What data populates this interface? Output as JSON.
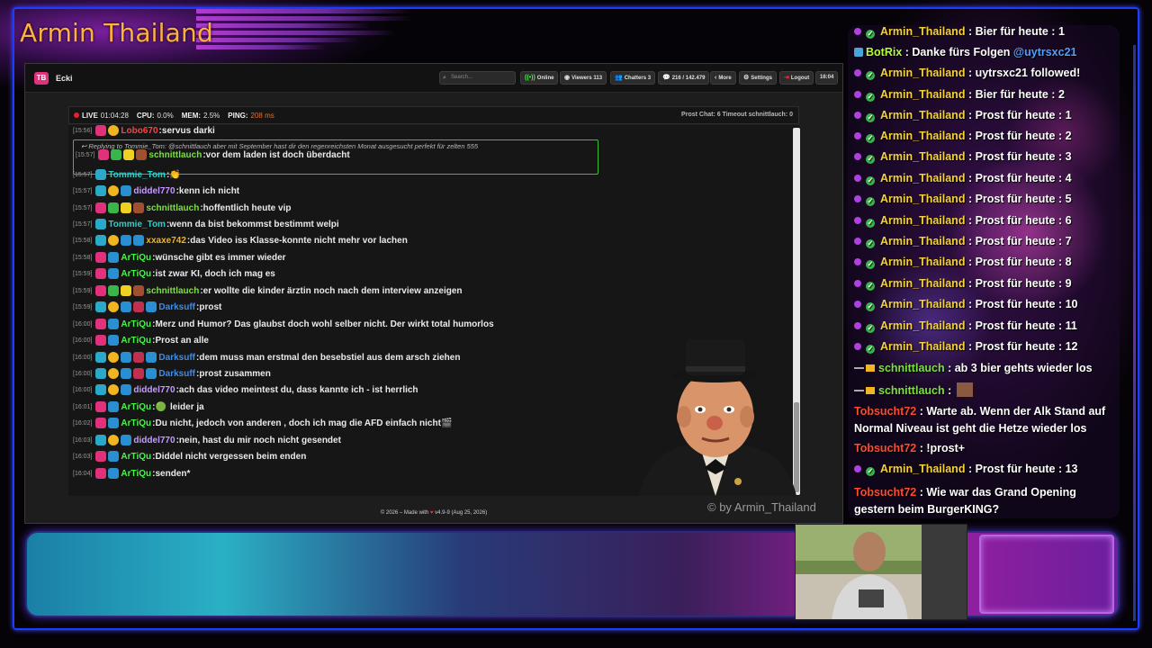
{
  "overlay": {
    "streamer_title": "Armin Thailand",
    "copyright": "© by Armin_Thailand"
  },
  "app": {
    "name": "Ecki",
    "logo_text": "TB",
    "search_placeholder": "Search...",
    "toolbar": {
      "online": "Online",
      "viewers_label": "Viewers",
      "viewers_count": "113",
      "chatters_label": "Chatters",
      "chatters_count": "3",
      "messages": "216 / 142.479",
      "more": "More",
      "settings": "Settings",
      "logout": "Logout",
      "clock": "16:04"
    },
    "status": {
      "live_label": "LIVE",
      "live_time": "01:04:28",
      "cpu_label": "CPU:",
      "cpu_value": "0.0%",
      "mem_label": "MEM:",
      "mem_value": "2.5%",
      "ping_label": "PING:",
      "ping_value": "208 ms",
      "right_text": "Prost Chat: 6  Timeout schnittlauch: 0"
    },
    "footer_prefix": "© 2026 – Made with",
    "footer_suffix": "v4.9-9 (Aug 25, 2026)"
  },
  "chat": {
    "partial_top": {
      "time": "[15:56]",
      "user": "Lobo670",
      "text": "servus darki"
    },
    "reply_context": "Replying to Tommie_Tom: @schnittlauch aber mit September hast dir den regenreichsten Monat ausgesucht perfekt für zelten 555",
    "messages": [
      {
        "time": "[15:57]",
        "user": "schnittlauch",
        "text": "vor dem laden ist doch überdacht",
        "color": "#7be040",
        "badges": [
          "#e0317a",
          "#3ab54a",
          "#f0d020",
          "#a05030"
        ]
      },
      {
        "time": "[15:57]",
        "user": "Tommie_Tom",
        "text": "",
        "color": "#2ad1c9",
        "badges": [
          "#2aa9c9"
        ],
        "emote": "👏"
      },
      {
        "time": "[15:57]",
        "user": "diddel770",
        "text": "kenn ich nicht",
        "color": "#c49cff",
        "badges": [
          "#2aa9c9",
          "#f0b520",
          "#2a8fd0"
        ]
      },
      {
        "time": "[15:57]",
        "user": "schnittlauch",
        "text": "hoffentlich heute vip",
        "color": "#7be040",
        "badges": [
          "#e0317a",
          "#3ab54a",
          "#f0d020",
          "#a05030"
        ]
      },
      {
        "time": "[15:57]",
        "user": "Tommie_Tom",
        "text": "wenn da bist bekommst bestimmt welpi",
        "color": "#2ad1c9",
        "badges": [
          "#2aa9c9"
        ]
      },
      {
        "time": "[15:58]",
        "user": "xxaxe742",
        "text": "das Video iss Klasse-konnte nicht mehr vor lachen",
        "color": "#f0b520",
        "badges": [
          "#2aa9c9",
          "#f0b520",
          "#2a8fd0",
          "#2a8fd0"
        ]
      },
      {
        "time": "[15:58]",
        "user": "ArTiQu",
        "text": "wünsche gibt es immer wieder",
        "color": "#4ef04e",
        "badges": [
          "#e0317a",
          "#2a8fd0"
        ]
      },
      {
        "time": "[15:59]",
        "user": "ArTiQu",
        "text": "ist zwar KI, doch ich mag es",
        "color": "#4ef04e",
        "badges": [
          "#e0317a",
          "#2a8fd0"
        ]
      },
      {
        "time": "[15:59]",
        "user": "schnittlauch",
        "text": "er wollte die kinder ärztin noch nach dem interview anzeigen",
        "color": "#7be040",
        "badges": [
          "#e0317a",
          "#3ab54a",
          "#f0d020",
          "#a05030"
        ]
      },
      {
        "time": "[15:59]",
        "user": "Darksuff",
        "text": "prost",
        "color": "#3a8ef0",
        "badges": [
          "#2aa9c9",
          "#f0b520",
          "#2a8fd0",
          "#c03050",
          "#2a8fd0"
        ]
      },
      {
        "time": "[16:00]",
        "user": "ArTiQu",
        "text": "Merz und Humor? Das glaubst doch wohl selber nicht. Der wirkt total humorlos",
        "color": "#4ef04e",
        "badges": [
          "#e0317a",
          "#2a8fd0"
        ]
      },
      {
        "time": "[16:00]",
        "user": "ArTiQu",
        "text": "Prost an alle",
        "color": "#4ef04e",
        "badges": [
          "#e0317a",
          "#2a8fd0"
        ]
      },
      {
        "time": "[16:00]",
        "user": "Darksuff",
        "text": "dem muss man erstmal den besebstiel aus dem arsch ziehen",
        "color": "#3a8ef0",
        "badges": [
          "#2aa9c9",
          "#f0b520",
          "#2a8fd0",
          "#c03050",
          "#2a8fd0"
        ]
      },
      {
        "time": "[16:00]",
        "user": "Darksuff",
        "text": "prost zusammen",
        "color": "#3a8ef0",
        "badges": [
          "#2aa9c9",
          "#f0b520",
          "#2a8fd0",
          "#c03050",
          "#2a8fd0"
        ]
      },
      {
        "time": "[16:00]",
        "user": "diddel770",
        "text": "ach das video meintest du, dass kannte ich - ist herrlich",
        "color": "#c49cff",
        "badges": [
          "#2aa9c9",
          "#f0b520",
          "#2a8fd0"
        ]
      },
      {
        "time": "[16:01]",
        "user": "ArTiQu",
        "text": "leider ja",
        "color": "#4ef04e",
        "badges": [
          "#e0317a",
          "#2a8fd0"
        ],
        "emote": "🟢"
      },
      {
        "time": "[16:02]",
        "user": "ArTiQu",
        "text": "Du nicht, jedoch von anderen , doch ich mag die AFD einfach nicht",
        "color": "#4ef04e",
        "badges": [
          "#e0317a",
          "#2a8fd0"
        ],
        "emote_after": "🎬"
      },
      {
        "time": "[16:03]",
        "user": "diddel770",
        "text": "nein, hast du mir noch nicht gesendet",
        "color": "#c49cff",
        "badges": [
          "#2aa9c9",
          "#f0b520",
          "#2a8fd0"
        ]
      },
      {
        "time": "[16:03]",
        "user": "ArTiQu",
        "text": "Diddel nicht vergessen beim enden",
        "color": "#4ef04e",
        "badges": [
          "#e0317a",
          "#2a8fd0"
        ]
      },
      {
        "time": "[16:04]",
        "user": "ArTiQu",
        "text": "senden*",
        "color": "#4ef04e",
        "badges": [
          "#e0317a",
          "#2a8fd0"
        ]
      }
    ]
  },
  "side_chat": [
    {
      "type": "arm",
      "user": "Armin_Thailand",
      "text": " : Bier für heute : 1"
    },
    {
      "type": "bot",
      "user": "BotRix",
      "text": " : Danke fürs Folgen ",
      "mention": "@uytrsxc21"
    },
    {
      "type": "arm",
      "user": "Armin_Thailand",
      "text": " : uytrsxc21 followed!"
    },
    {
      "type": "arm",
      "user": "Armin_Thailand",
      "text": " : Bier für heute : 2"
    },
    {
      "type": "arm",
      "user": "Armin_Thailand",
      "text": " : Prost für heute : 1"
    },
    {
      "type": "arm",
      "user": "Armin_Thailand",
      "text": " : Prost für heute : 2"
    },
    {
      "type": "arm",
      "user": "Armin_Thailand",
      "text": " : Prost für heute : 3"
    },
    {
      "type": "arm",
      "user": "Armin_Thailand",
      "text": " : Prost für heute : 4"
    },
    {
      "type": "arm",
      "user": "Armin_Thailand",
      "text": " : Prost für heute : 5"
    },
    {
      "type": "arm",
      "user": "Armin_Thailand",
      "text": " : Prost für heute : 6"
    },
    {
      "type": "arm",
      "user": "Armin_Thailand",
      "text": " : Prost für heute : 7"
    },
    {
      "type": "arm",
      "user": "Armin_Thailand",
      "text": " : Prost für heute : 8"
    },
    {
      "type": "arm",
      "user": "Armin_Thailand",
      "text": " : Prost für heute : 9"
    },
    {
      "type": "arm",
      "user": "Armin_Thailand",
      "text": " : Prost für heute : 10"
    },
    {
      "type": "arm",
      "user": "Armin_Thailand",
      "text": " : Prost für heute : 11"
    },
    {
      "type": "arm",
      "user": "Armin_Thailand",
      "text": " : Prost für heute : 12"
    },
    {
      "type": "sch",
      "user": "schnittlauch",
      "text": " : ab 3 bier gehts wieder los"
    },
    {
      "type": "sch",
      "user": "schnittlauch",
      "text": " : "
    },
    {
      "type": "tob",
      "user": "Tobsucht72",
      "text": " : Warte ab. Wenn der Alk Stand auf Normal Niveau ist geht die Hetze wieder los"
    },
    {
      "type": "tob",
      "user": "Tobsucht72",
      "text": " : !prost+"
    },
    {
      "type": "arm",
      "user": "Armin_Thailand",
      "text": " : Prost für heute : 13"
    },
    {
      "type": "tob",
      "user": "Tobsucht72",
      "text": " : Wie war das Grand Opening gestern beim BurgerKING?"
    }
  ]
}
